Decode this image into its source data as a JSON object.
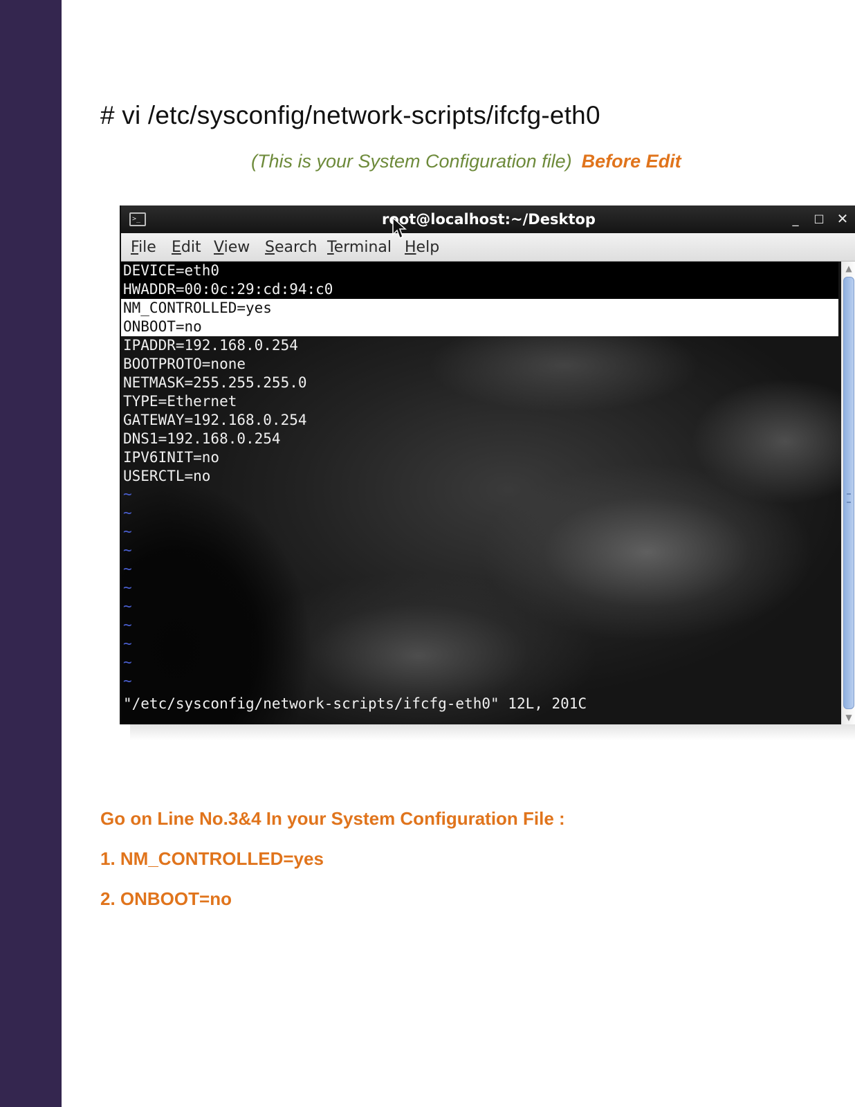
{
  "page": {
    "heading": "# vi /etc/sysconfig/network-scripts/ifcfg-eth0",
    "subtitle_note": "(This is your System Configuration file)",
    "subtitle_tag": "Before Edit"
  },
  "terminal": {
    "title": "root@localhost:~/Desktop",
    "window_buttons": {
      "minimize": "_",
      "maximize": "□",
      "close": "✕"
    },
    "icon": "terminal-icon",
    "menu": [
      "File",
      "Edit",
      "View",
      "Search",
      "Terminal",
      "Help"
    ],
    "lines": [
      "DEVICE=eth0",
      "HWADDR=00:0c:29:cd:94:c0",
      "NM_CONTROLLED=yes",
      "ONBOOT=no",
      "IPADDR=192.168.0.254",
      "BOOTPROTO=none",
      "NETMASK=255.255.255.0",
      "TYPE=Ethernet",
      "GATEWAY=192.168.0.254",
      "DNS1=192.168.0.254",
      "IPV6INIT=no",
      "USERCTL=no"
    ],
    "empty_marker": "~",
    "empty_line_count": 11,
    "status_line": "\"/etc/sysconfig/network-scripts/ifcfg-eth0\" 12L, 201C",
    "highlighted_lines": [
      3,
      4
    ],
    "colors": {
      "highlight_bg": "#ffffff",
      "tilde": "#4a5fd0",
      "scroll_thumb": "#a6c0ea"
    }
  },
  "instructions": {
    "heading": "Go on Line No.3&4 In your System Configuration File :",
    "item1": "1. NM_CONTROLLED=yes",
    "item2": "2. ONBOOT=no"
  },
  "colors": {
    "sidebar": "#34264f",
    "accent": "#e0741c",
    "note": "#6d8a3a"
  }
}
